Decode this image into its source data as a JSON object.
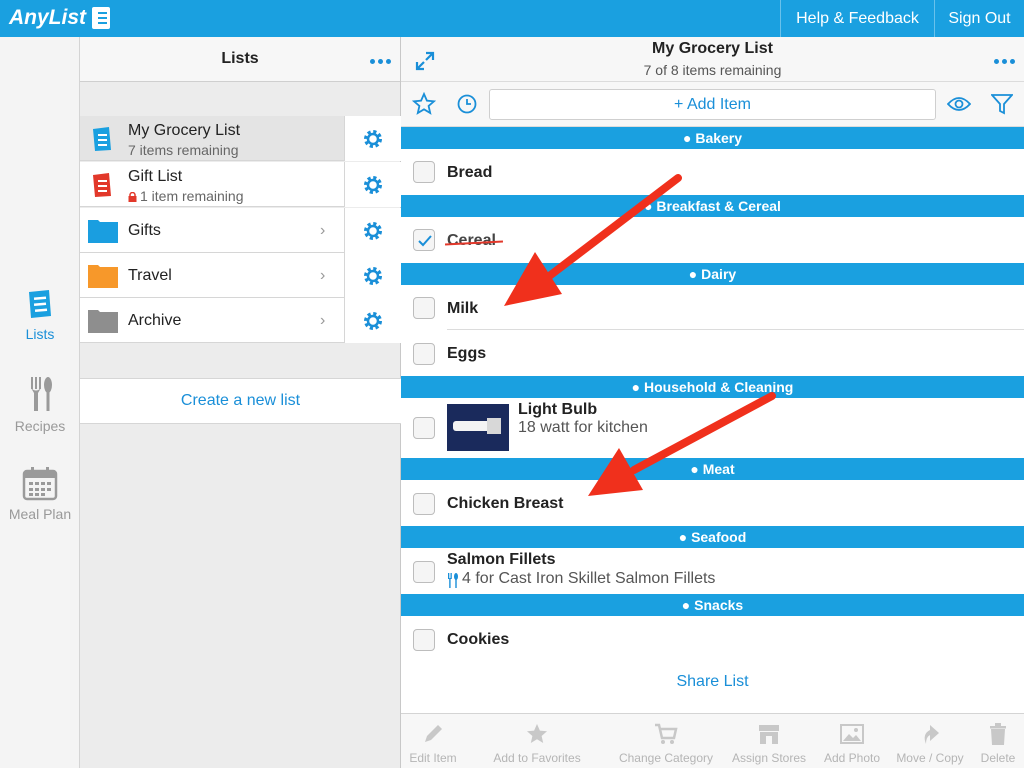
{
  "app": {
    "logo_text": "AnyList"
  },
  "header": {
    "help_label": "Help & Feedback",
    "signout_label": "Sign Out"
  },
  "rail": {
    "lists_label": "Lists",
    "recipes_label": "Recipes",
    "mealplan_label": "Meal Plan"
  },
  "lists_panel": {
    "title": "Lists",
    "items": [
      {
        "title": "My Grocery List",
        "subtitle": "7 items remaining",
        "icon": "list-icon-blue"
      },
      {
        "title": "Gift List",
        "subtitle": "1 item remaining",
        "icon": "list-icon-red"
      },
      {
        "title": "Gifts",
        "icon": "folder-icon-blue"
      },
      {
        "title": "Travel",
        "icon": "folder-icon-orange"
      },
      {
        "title": "Archive",
        "icon": "folder-icon-gray"
      }
    ],
    "create_label": "Create a new list"
  },
  "main": {
    "title": "My Grocery List",
    "subtitle": "7 of 8 items remaining",
    "add_item_label": "+ Add Item",
    "sections": [
      {
        "name": "Bakery",
        "icon": "bread-icon"
      },
      {
        "name": "Breakfast & Cereal",
        "icon": "bowl-icon"
      },
      {
        "name": "Dairy",
        "icon": "cheese-icon"
      },
      {
        "name": "Household & Cleaning",
        "icon": "spray-icon"
      },
      {
        "name": "Meat",
        "icon": "turkey-icon"
      },
      {
        "name": "Seafood",
        "icon": "fish-icon"
      },
      {
        "name": "Snacks",
        "icon": "pretzel-icon"
      }
    ],
    "items": [
      {
        "name": "Bread",
        "checked": false
      },
      {
        "name": "Cereal",
        "checked": true
      },
      {
        "name": "Milk",
        "checked": false
      },
      {
        "name": "Eggs",
        "checked": false
      },
      {
        "name": "Light Bulb",
        "note": "18 watt for kitchen",
        "checked": false,
        "has_photo": true
      },
      {
        "name": "Chicken Breast",
        "checked": false
      },
      {
        "name": "Salmon Fillets",
        "note": "4 for Cast Iron Skillet Salmon Fillets",
        "checked": false
      },
      {
        "name": "Cookies",
        "checked": false
      }
    ],
    "share_label": "Share List"
  },
  "bottom_toolbar": [
    {
      "label": "Edit Item",
      "icon": "pencil-icon"
    },
    {
      "label": "Add to Favorites",
      "icon": "star-icon"
    },
    {
      "label": "Change Category",
      "icon": "cart-icon"
    },
    {
      "label": "Assign Stores",
      "icon": "store-icon"
    },
    {
      "label": "Add Photo",
      "icon": "photo-icon"
    },
    {
      "label": "Move / Copy",
      "icon": "move-icon"
    },
    {
      "label": "Delete",
      "icon": "trash-icon"
    }
  ],
  "colors": {
    "accent": "#1aa0e0",
    "link": "#1a8fd8",
    "arrow": "#f0301c"
  }
}
